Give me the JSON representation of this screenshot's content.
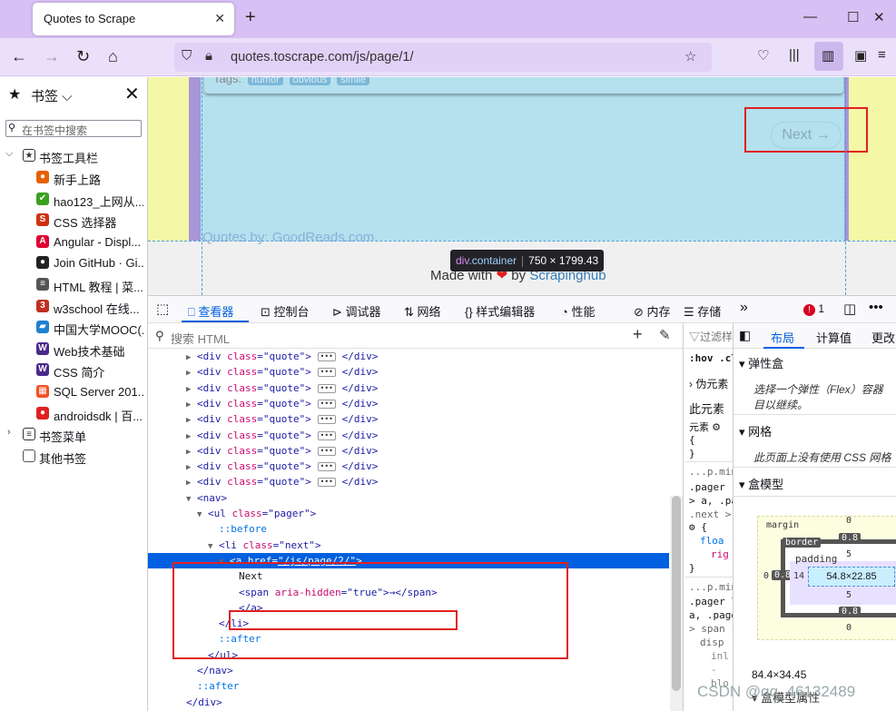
{
  "browser": {
    "tab_title": "Quotes to Scrape",
    "url": "quotes.toscrape.com/js/page/1/"
  },
  "sidebar": {
    "title": "书签",
    "search_placeholder": "在书签中搜索",
    "toolbar_folder": "书签工具栏",
    "items": [
      {
        "label": "新手上路",
        "icon": "firefox-icon",
        "color": "#e66000"
      },
      {
        "label": "hao123_上网从...",
        "icon": "hao123-icon",
        "color": "#3aa020"
      },
      {
        "label": "CSS 选择器",
        "icon": "w3-icon",
        "color": "#d03010"
      },
      {
        "label": "Angular - Displ...",
        "icon": "angular-icon",
        "color": "#dd0031"
      },
      {
        "label": "Join GitHub · Gi...",
        "icon": "github-icon",
        "color": "#222222"
      },
      {
        "label": "HTML 教程 | 菜...",
        "icon": "runoob-icon",
        "color": "#555555"
      },
      {
        "label": "w3school 在线...",
        "icon": "w3school-icon",
        "color": "#c03020"
      },
      {
        "label": "中国大学MOOC(...",
        "icon": "mooc-icon",
        "color": "#2080d0"
      },
      {
        "label": "Web技术基础",
        "icon": "w-icon",
        "color": "#4b2a8a"
      },
      {
        "label": "CSS 简介",
        "icon": "w-icon",
        "color": "#4b2a8a"
      },
      {
        "label": "SQL Server 201...",
        "icon": "microsoft-icon",
        "color": "#f25022"
      },
      {
        "label": "androidsdk | 百...",
        "icon": "pin-icon",
        "color": "#e02020"
      }
    ],
    "menu_folder": "书签菜单",
    "other_folder": "其他书签"
  },
  "page": {
    "tags_label": "Tags:",
    "tags": [
      "humor",
      "obvious",
      "simile"
    ],
    "next_label": "Next →",
    "footer_quotes_by": "Quotes by:",
    "footer_goodreads": "GoodReads.com",
    "made_with": "Made with",
    "by": "by",
    "scrapinghub": "Scrapinghub",
    "tooltip_tag": "div",
    "tooltip_class": ".container",
    "tooltip_size": "750 × 1799.43"
  },
  "devtools": {
    "tabs": [
      "查看器",
      "控制台",
      "调试器",
      "网络",
      "样式编辑器",
      "性能",
      "内存",
      "存储"
    ],
    "error_count": "1",
    "search_placeholder": "搜索 HTML",
    "markup": {
      "quote_tag": "<div ",
      "class_attr": "class",
      "quote_val": "\"quote\"",
      "close_div": "</div>",
      "nav_open": "<nav>",
      "ul_open": "<ul ",
      "pager_val": "\"pager\"",
      "before": "::before",
      "li_open": "<li ",
      "next_val": "\"next\"",
      "a_open": "<a ",
      "href_attr": "href",
      "href_val": "\"/js/page/2/\"",
      "next_text": "Next",
      "span_open": "<span ",
      "aria_attr": "aria-hidden",
      "aria_val": "\"true\"",
      "span_rest": ">→</span>",
      "a_close": "</a>",
      "li_close": "</li>",
      "after": "::after",
      "ul_close": "</ul>",
      "nav_close": "</nav>",
      "div_close": "</div>"
    },
    "rules": {
      "filter": "过滤样",
      "hov": ":hov",
      "cls": ".cl",
      "pseudo": "伪元素",
      "this_element": "此元素",
      "element": "元素",
      "brace_open": "{",
      "brace_close": "}",
      "src1": "...p.min.c",
      "sel1a": ".pager .",
      "sel1b": "> a, .pa",
      "sel1c": ".next >",
      "prop1": "floa",
      "prop1v": "rig",
      "src2": "...p.min.c",
      "sel2a": ".pager l",
      "sel2b": "a, .page",
      "sel2c": "> span {",
      "prop2": "disp",
      "prop2v": "inl",
      "prop2c": "-",
      "prop2d": "blo"
    },
    "layout": {
      "tabs": [
        "布局",
        "计算值",
        "更改"
      ],
      "flex_title": "弹性盒",
      "flex_desc1": "选择一个弹性（Flex）容器",
      "flex_desc2": "目以继续。",
      "grid_title": "网格",
      "grid_desc": "此页面上没有使用 CSS 网格",
      "box_title": "盒模型",
      "margin": "margin",
      "border": "border",
      "padding": "padding",
      "margin_top": "0",
      "margin_bottom": "0",
      "margin_left": "0",
      "border_top": "0.8",
      "border_bottom": "0.8",
      "border_left": "0.8",
      "padding_top": "5",
      "padding_bottom": "5",
      "padding_left": "14",
      "content": "54.8×22.85",
      "size": "84.4×34.45",
      "props": "盒模型属性"
    }
  },
  "watermark": "CSDN @qq_46132489"
}
